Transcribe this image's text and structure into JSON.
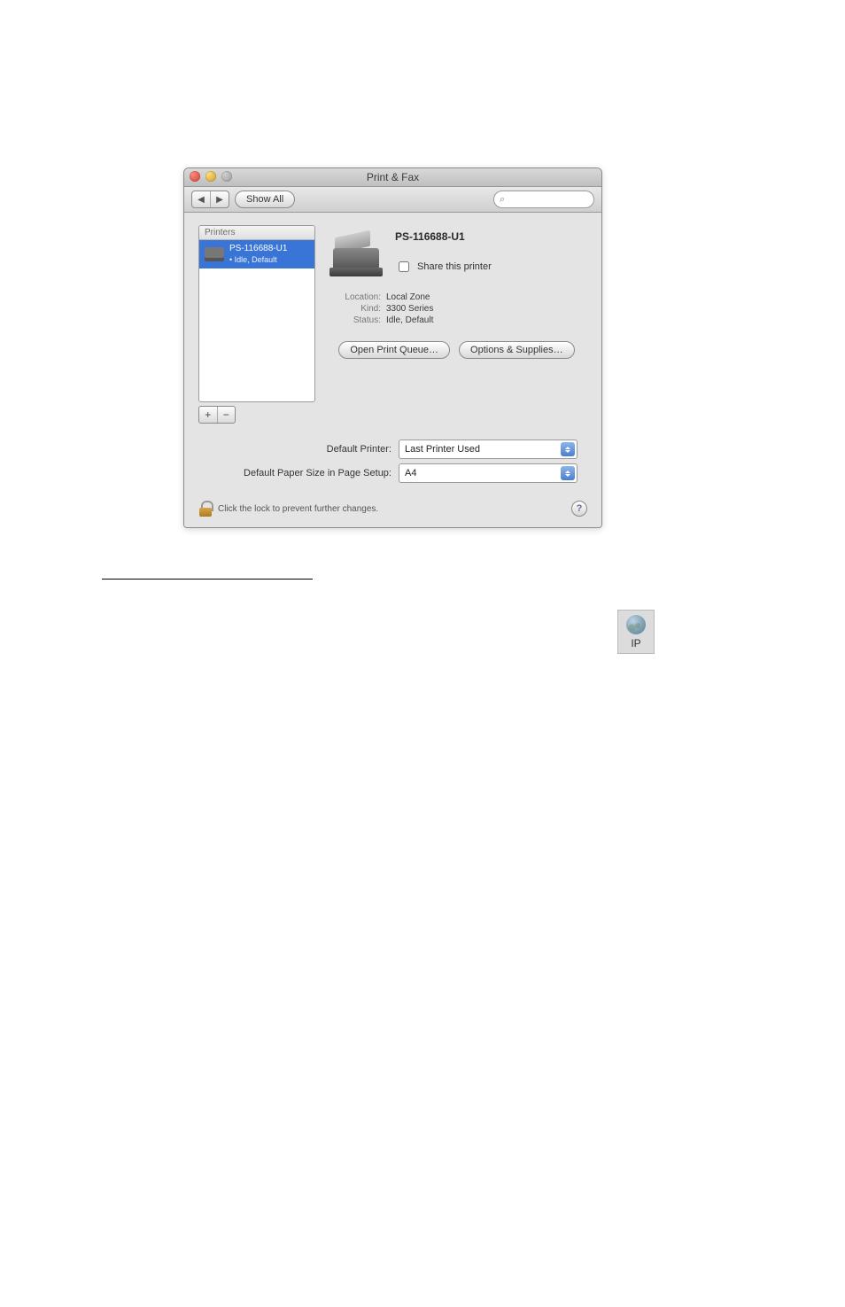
{
  "window": {
    "title": "Print & Fax"
  },
  "toolbar": {
    "back_glyph": "◀",
    "fwd_glyph": "▶",
    "showall_label": "Show All",
    "search_icon_glyph": "⌕"
  },
  "sidebar": {
    "header": "Printers",
    "selected": {
      "name": "PS-116688-U1",
      "status": "• Idle, Default"
    },
    "plus": "+",
    "minus": "−"
  },
  "detail": {
    "name": "PS-116688-U1",
    "share_label": "Share this printer",
    "kvs": {
      "location_k": "Location:",
      "location_v": "Local Zone",
      "kind_k": "Kind:",
      "kind_v": "3300 Series",
      "status_k": "Status:",
      "status_v": "Idle, Default"
    },
    "buttons": {
      "queue": "Open Print Queue…",
      "options": "Options & Supplies…"
    }
  },
  "defaults": {
    "printer_label": "Default Printer:",
    "printer_value": "Last Printer Used",
    "paper_label": "Default Paper Size in Page Setup:",
    "paper_value": "A4"
  },
  "lock": {
    "text": "Click the lock to prevent further changes.",
    "help": "?"
  },
  "ipthumb": {
    "label": "IP"
  }
}
